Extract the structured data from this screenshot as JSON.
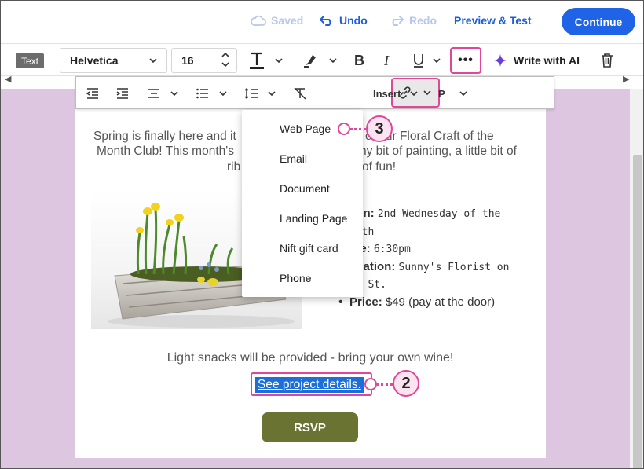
{
  "topbar": {
    "saved": "Saved",
    "undo": "Undo",
    "redo": "Redo",
    "preview": "Preview & Test",
    "continue": "Continue"
  },
  "toolbar": {
    "block_type": "Text",
    "font_family": "Helvetica",
    "font_size": "16",
    "more": "•••",
    "write_ai": "Write with AI"
  },
  "subbar": {
    "insert": "Insert",
    "paragraph": "P"
  },
  "link_menu": {
    "items": [
      "Web Page",
      "Email",
      "Document",
      "Landing Page",
      "Nift gift card",
      "Phone"
    ]
  },
  "email": {
    "intro_lines": [
      "Spring is finally here and it",
      "Month Club! This month's",
      "rib"
    ],
    "intro_right_lines": [
      "of our Floral Craft of the",
      "ny bit of painting, a little bit of",
      "of fun!"
    ],
    "details": [
      {
        "label": "hen:",
        "value": "2nd Wednesday of the"
      },
      {
        "label": "",
        "value": "onth"
      },
      {
        "label": "me:",
        "value": "6:30pm"
      },
      {
        "label": "ocation:",
        "value": "Sunny's Florist on"
      },
      {
        "label": "",
        "value": "in St."
      },
      {
        "label": "Price:",
        "value": "$49 (pay at the door)"
      }
    ],
    "snacks": "Light snacks will be provided - bring your own wine!",
    "project_link": "See project details.",
    "rsvp": "RSVP"
  },
  "callouts": {
    "step2": "2",
    "step3": "3"
  },
  "colors": {
    "accent": "#1f63e6",
    "highlight": "#e0479a",
    "canvas_bg": "#dcc6e0",
    "rsvp_bg": "#6a7331"
  }
}
